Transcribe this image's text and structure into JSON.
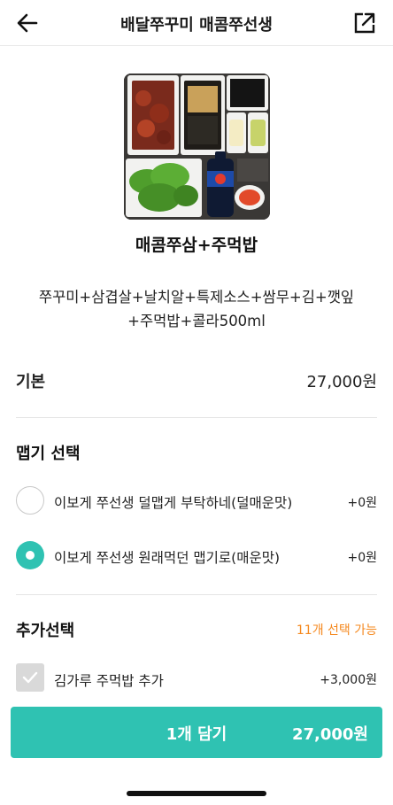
{
  "header": {
    "title": "배달쭈꾸미 매콤쭈선생",
    "back_icon": "arrow-left-icon",
    "share_icon": "external-link-icon"
  },
  "product": {
    "name": "매콤쭈삼+주먹밥",
    "description_line1": "쭈꾸미+삼겹살+날치알+특제소스+쌈무+김+깻잎",
    "description_line2": "+주먹밥+콜라500ml"
  },
  "base": {
    "label": "기본",
    "price": "27,000원"
  },
  "spicy": {
    "title": "맵기 선택",
    "options": [
      {
        "label": "이보게 쭈선생 덜맵게 부탁하네(덜매운맛)",
        "price": "+0원",
        "selected": false
      },
      {
        "label": "이보게 쭈선생 원래먹던 맵기로(매운맛)",
        "price": "+0원",
        "selected": true
      }
    ]
  },
  "extras": {
    "title": "추가선택",
    "note": "11개 선택 가능",
    "items": [
      {
        "label": "김가루 주먹밥 추가",
        "price": "+3,000원",
        "checked": false
      }
    ]
  },
  "cta": {
    "label": "1개 담기",
    "price": "27,000원"
  },
  "colors": {
    "accent": "#2fc2b2",
    "orange": "#f5891f"
  }
}
